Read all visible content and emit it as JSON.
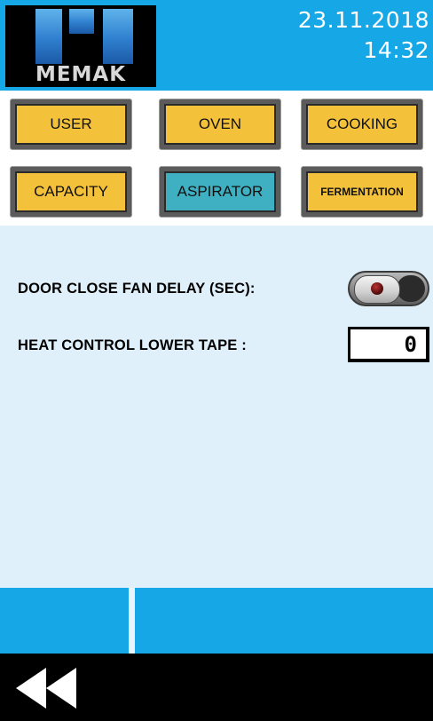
{
  "header": {
    "logo_text": "MEMAK",
    "date": "23.11.2018",
    "time": "14:32"
  },
  "tabs": [
    {
      "label": "USER",
      "active": false
    },
    {
      "label": "OVEN",
      "active": false
    },
    {
      "label": "COOKING",
      "active": false
    },
    {
      "label": "CAPACITY",
      "active": false
    },
    {
      "label": "ASPIRATOR",
      "active": true
    },
    {
      "label": "FERMENTATION",
      "active": false
    }
  ],
  "settings": {
    "door_fan_delay_label": "DOOR CLOSE FAN DELAY (SEC):",
    "door_fan_toggle_state": "off",
    "heat_control_label": "HEAT CONTROL LOWER TAPE :",
    "heat_control_value": "0"
  },
  "footer": {
    "back_icon": "rewind-icon"
  },
  "colors": {
    "header_blue": "#16a7e6",
    "tab_yellow": "#f3c23a",
    "tab_active": "#3eb0c2",
    "content_bg": "#dff0fb"
  }
}
